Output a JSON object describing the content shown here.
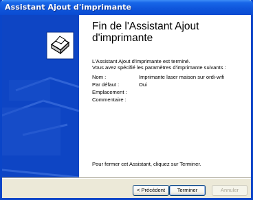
{
  "window": {
    "title": "Assistant Ajout d'imprimante"
  },
  "content": {
    "heading": "Fin de l'Assistant Ajout\nd'imprimante",
    "intro_line1": "L'Assistant Ajout d'imprimante est terminé.",
    "intro_line2": "Vous avez spécifié les paramètres d'imprimante suivants :",
    "fields": [
      {
        "label": "Nom :",
        "value": "Imprimante laser maison sur ordi-wifi"
      },
      {
        "label": "Par défaut :",
        "value": "Oui"
      },
      {
        "label": "Emplacement :",
        "value": ""
      },
      {
        "label": "Commentaire :",
        "value": ""
      }
    ],
    "closing": "Pour fermer cet Assistant, cliquez sur Terminer."
  },
  "buttons": {
    "back": "< Précédent",
    "finish": "Terminer",
    "cancel": "Annuler"
  },
  "colors": {
    "titlebar": "#0a4bd1",
    "left_panel": "#0e45c4",
    "dialog_bg": "#ece9d8"
  },
  "icons": {
    "wizard": "printer-wizard-icon"
  }
}
